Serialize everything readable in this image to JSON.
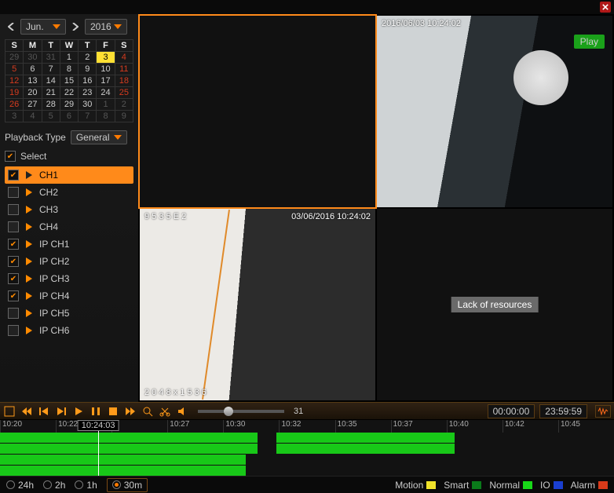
{
  "header": {
    "close_icon": "close"
  },
  "calendar": {
    "month_label": "Jun.",
    "year_label": "2016",
    "dow": [
      "S",
      "M",
      "T",
      "W",
      "T",
      "F",
      "S"
    ],
    "weeks": [
      [
        {
          "d": "29",
          "c": "gray"
        },
        {
          "d": "30",
          "c": "gray"
        },
        {
          "d": "31",
          "c": "gray"
        },
        {
          "d": "1"
        },
        {
          "d": "2"
        },
        {
          "d": "3",
          "c": "today"
        },
        {
          "d": "4",
          "c": "red"
        }
      ],
      [
        {
          "d": "5",
          "c": "red"
        },
        {
          "d": "6"
        },
        {
          "d": "7"
        },
        {
          "d": "8"
        },
        {
          "d": "9"
        },
        {
          "d": "10"
        },
        {
          "d": "11",
          "c": "red"
        }
      ],
      [
        {
          "d": "12",
          "c": "red"
        },
        {
          "d": "13"
        },
        {
          "d": "14"
        },
        {
          "d": "15"
        },
        {
          "d": "16"
        },
        {
          "d": "17"
        },
        {
          "d": "18",
          "c": "red"
        }
      ],
      [
        {
          "d": "19",
          "c": "red"
        },
        {
          "d": "20"
        },
        {
          "d": "21"
        },
        {
          "d": "22"
        },
        {
          "d": "23"
        },
        {
          "d": "24"
        },
        {
          "d": "25",
          "c": "red"
        }
      ],
      [
        {
          "d": "26",
          "c": "red"
        },
        {
          "d": "27"
        },
        {
          "d": "28"
        },
        {
          "d": "29"
        },
        {
          "d": "30"
        },
        {
          "d": "1",
          "c": "gray"
        },
        {
          "d": "2",
          "c": "gray"
        }
      ],
      [
        {
          "d": "3",
          "c": "gray"
        },
        {
          "d": "4",
          "c": "gray"
        },
        {
          "d": "5",
          "c": "gray"
        },
        {
          "d": "6",
          "c": "gray"
        },
        {
          "d": "7",
          "c": "gray"
        },
        {
          "d": "8",
          "c": "gray"
        },
        {
          "d": "9",
          "c": "gray"
        }
      ]
    ]
  },
  "playback_type": {
    "label": "Playback Type",
    "value": "General"
  },
  "select_all_label": "Select",
  "channels": [
    {
      "label": "CH1",
      "checked": true,
      "selected": true
    },
    {
      "label": "CH2",
      "checked": false
    },
    {
      "label": "CH3",
      "checked": false
    },
    {
      "label": "CH4",
      "checked": false
    },
    {
      "label": "IP CH1",
      "checked": true
    },
    {
      "label": "IP CH2",
      "checked": true
    },
    {
      "label": "IP CH3",
      "checked": true
    },
    {
      "label": "IP CH4",
      "checked": true
    },
    {
      "label": "IP CH5",
      "checked": false
    },
    {
      "label": "IP CH6",
      "checked": false
    }
  ],
  "panes": {
    "p1": {},
    "p2": {
      "osd_tl": "2016/06/03 10:24:02",
      "play_label": "Play"
    },
    "p3": {
      "osd_tl": "9 5 3 5 E 2",
      "osd_tr": "03/06/2016  10:24:02",
      "osd_bl": "2 0 4 8 x 1 5 3 6"
    },
    "p4": {
      "message": "Lack of resources"
    }
  },
  "controls": {
    "volume_value": "31",
    "elapsed": "00:00:00",
    "total": "23:59:59"
  },
  "timeline": {
    "ticks": [
      "10:20",
      "10:22",
      "10:24:03",
      "10:27",
      "10:30",
      "10:32",
      "10:35",
      "10:37",
      "10:40",
      "10:42",
      "10:45"
    ],
    "playhead_label": "10:24:03",
    "playhead_pct": 16,
    "rows": 4,
    "segments": [
      {
        "row": 0,
        "start": 0,
        "end": 42
      },
      {
        "row": 0,
        "start": 45,
        "end": 74
      },
      {
        "row": 1,
        "start": 0,
        "end": 42
      },
      {
        "row": 1,
        "start": 45,
        "end": 74
      },
      {
        "row": 2,
        "start": 0,
        "end": 40
      },
      {
        "row": 3,
        "start": 0,
        "end": 40
      }
    ]
  },
  "zoom": {
    "options": [
      {
        "label": "24h",
        "on": false
      },
      {
        "label": "2h",
        "on": false
      },
      {
        "label": "1h",
        "on": false
      },
      {
        "label": "30m",
        "on": true
      }
    ]
  },
  "legend": [
    {
      "label": "Motion",
      "color": "#f0e22a"
    },
    {
      "label": "Smart",
      "color": "#0a7a1a"
    },
    {
      "label": "Normal",
      "color": "#18d818"
    },
    {
      "label": "IO",
      "color": "#1a3fd0"
    },
    {
      "label": "Alarm",
      "color": "#d83a1a"
    }
  ]
}
